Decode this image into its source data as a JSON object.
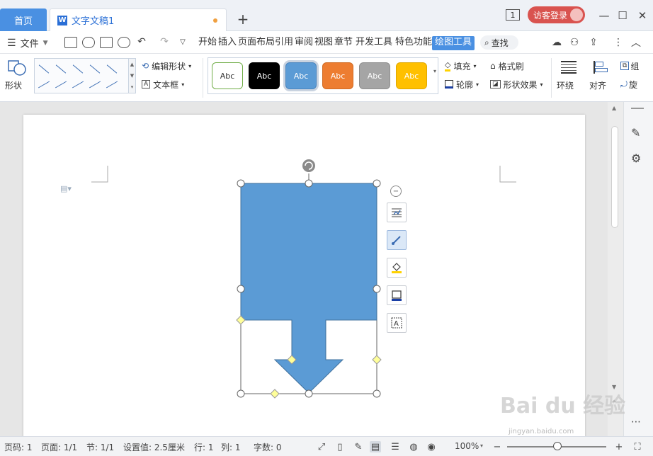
{
  "tabs": {
    "home": "首页",
    "doc_title": "文字文稿1",
    "add": "+"
  },
  "window": {
    "count": "1",
    "login": "访客登录",
    "minimize": "—",
    "maximize": "☐",
    "close": "✕"
  },
  "menu": {
    "file": "文件",
    "items": [
      "开始",
      "插入",
      "页面布局",
      "引用",
      "审阅",
      "视图",
      "章节",
      "开发工具",
      "特色功能",
      "绘图工具"
    ],
    "active": "绘图工具",
    "search": "查找"
  },
  "ribbon": {
    "shapes": "形状",
    "edit_shape": "编辑形状",
    "textbox": "文本框",
    "styles": [
      {
        "label": "Abc",
        "bg": "#ffffff",
        "fg": "#333333",
        "border": "#70ad47"
      },
      {
        "label": "Abc",
        "bg": "#000000",
        "fg": "#ffffff",
        "border": "#000000"
      },
      {
        "label": "Abc",
        "bg": "#5b9bd5",
        "fg": "#ffffff",
        "border": "#4a86c0"
      },
      {
        "label": "Abc",
        "bg": "#ed7d31",
        "fg": "#ffffff",
        "border": "#d06a22"
      },
      {
        "label": "Abc",
        "bg": "#a5a5a5",
        "fg": "#ffffff",
        "border": "#8e8e8e"
      },
      {
        "label": "Abc",
        "bg": "#ffc000",
        "fg": "#ffffff",
        "border": "#e0a800"
      }
    ],
    "fill": "填充",
    "outline": "轮廓",
    "format_painter": "格式刷",
    "shape_effects": "形状效果",
    "wrap": "环绕",
    "align": "对齐",
    "group": "组",
    "rotate": "旋"
  },
  "status": {
    "page_num": "页码: 1",
    "pages": "页面: 1/1",
    "section": "节: 1/1",
    "setting": "设置值: 2.5厘米",
    "row": "行: 1",
    "col": "列: 1",
    "words": "字数: 0",
    "zoom": "100%"
  },
  "watermark": {
    "main": "Bai du 经验",
    "sub": "jingyan.baidu.com"
  },
  "colors": {
    "accent": "#4a90e2",
    "shape_fill": "#5b9bd5",
    "login": "#d9534f"
  }
}
